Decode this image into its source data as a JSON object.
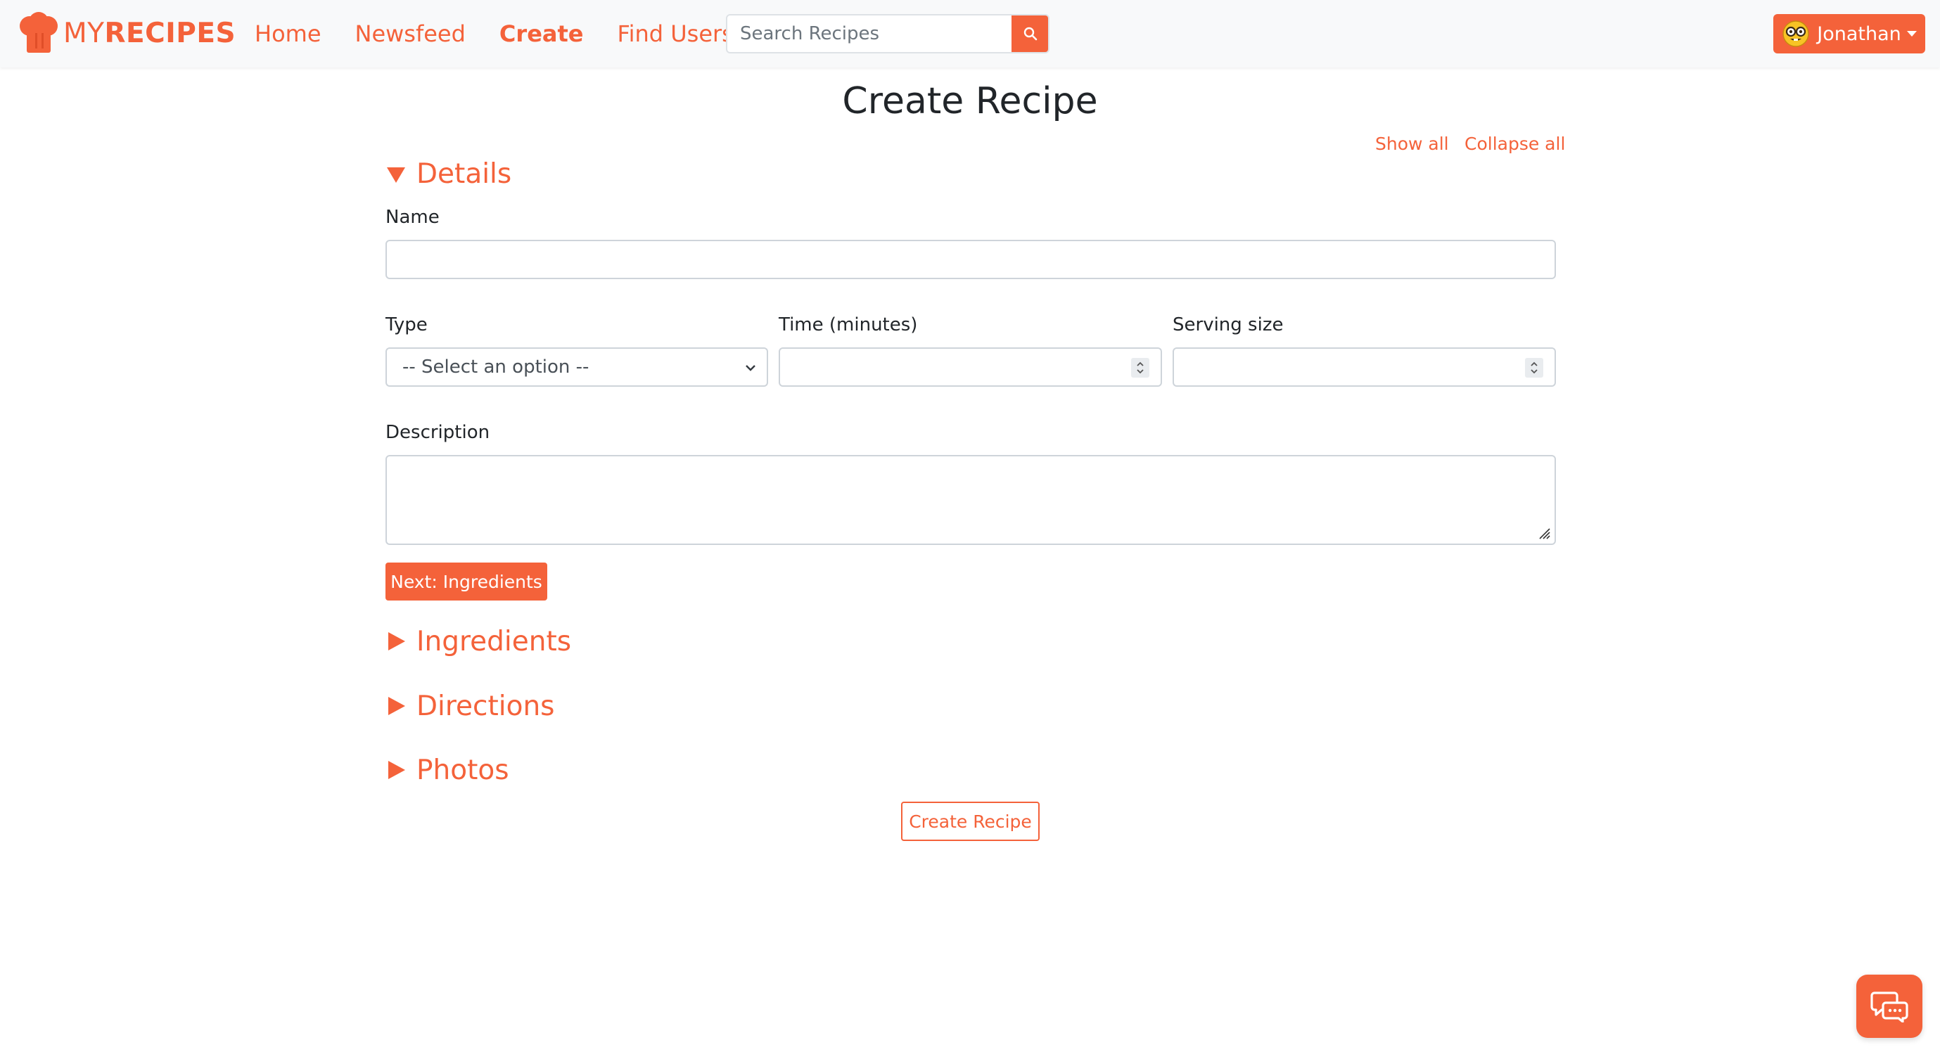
{
  "brand": {
    "name_light": "MY",
    "name_bold": "RECIPES",
    "icon": "chef-hat-icon",
    "color": "#f4623a"
  },
  "nav": {
    "links": [
      {
        "label": "Home",
        "active": false
      },
      {
        "label": "Newsfeed",
        "active": false
      },
      {
        "label": "Create",
        "active": true
      },
      {
        "label": "Find Users",
        "active": false
      }
    ]
  },
  "search": {
    "placeholder": "Search Recipes",
    "value": "",
    "icon": "search-icon"
  },
  "user": {
    "name": "Jonathan",
    "avatar": "nerd-face-emoji",
    "icon": "caret-down-icon"
  },
  "main": {
    "title": "Create Recipe",
    "show_all": "Show all",
    "collapse_all": "Collapse all"
  },
  "sections": {
    "details": {
      "label": "Details",
      "expanded": true
    },
    "ingredients": {
      "label": "Ingredients",
      "expanded": false
    },
    "directions": {
      "label": "Directions",
      "expanded": false
    },
    "photos": {
      "label": "Photos",
      "expanded": false
    }
  },
  "form": {
    "name": {
      "label": "Name",
      "value": ""
    },
    "type": {
      "label": "Type",
      "selected": "-- Select an option --"
    },
    "time": {
      "label": "Time (minutes)",
      "value": ""
    },
    "serving": {
      "label": "Serving size",
      "value": ""
    },
    "description": {
      "label": "Description",
      "value": ""
    },
    "next_button": "Next: Ingredients",
    "submit_button": "Create Recipe"
  },
  "chat": {
    "icon": "chat-bubbles-icon"
  }
}
